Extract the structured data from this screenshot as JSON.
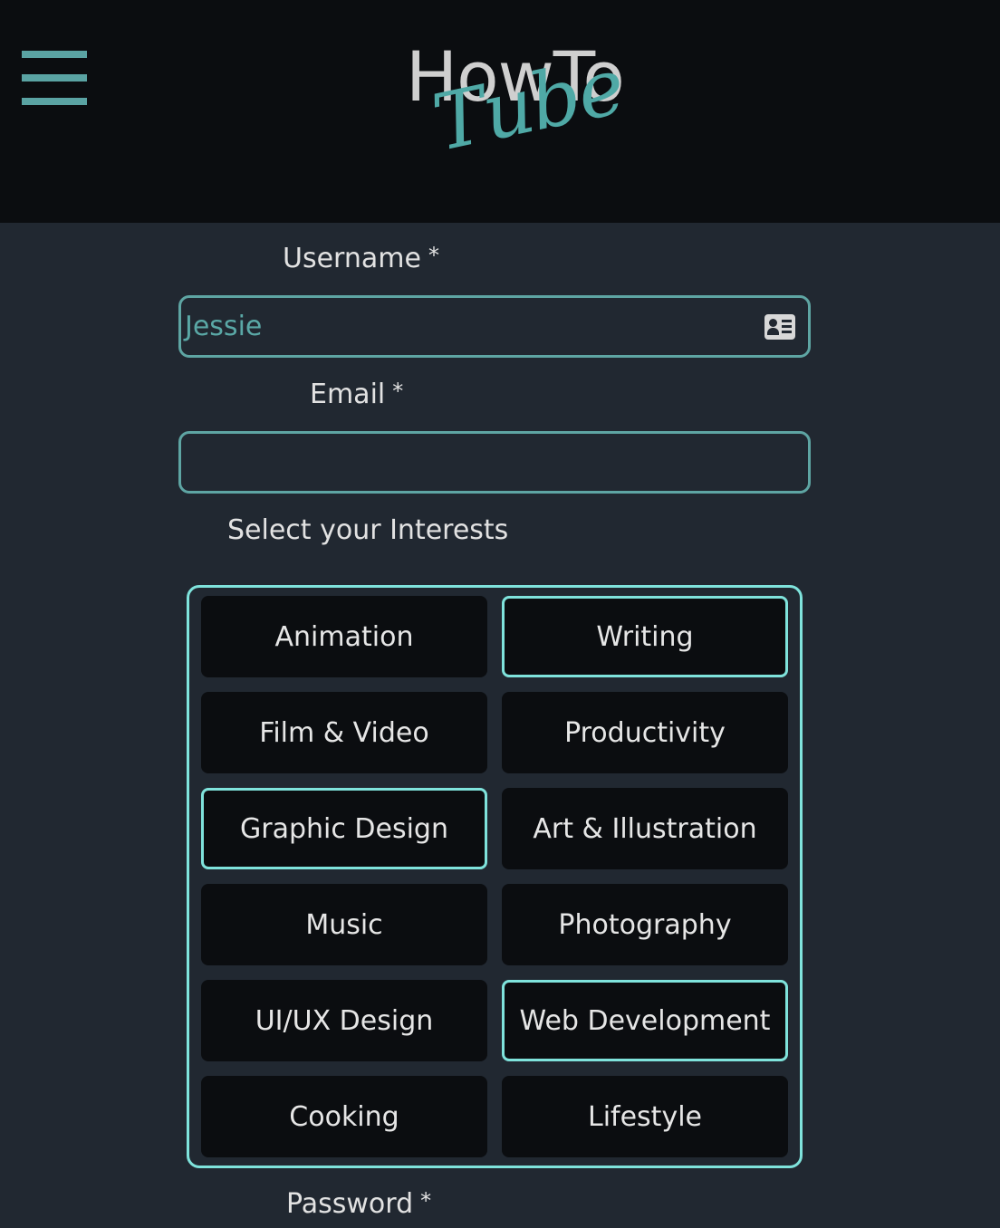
{
  "header": {
    "menu_icon": "hamburger-menu-icon",
    "logo_top": "HowTo",
    "logo_bottom": "Tube"
  },
  "form": {
    "username": {
      "label": "Username",
      "required_mark": "*",
      "value": "Jessie",
      "icon": "contact-card-icon"
    },
    "email": {
      "label": "Email",
      "required_mark": "*",
      "value": ""
    },
    "interests": {
      "label": "Select your Interests",
      "items": [
        {
          "label": "Animation",
          "selected": false
        },
        {
          "label": "Writing",
          "selected": true
        },
        {
          "label": "Film & Video",
          "selected": false
        },
        {
          "label": "Productivity",
          "selected": false
        },
        {
          "label": "Graphic Design",
          "selected": true
        },
        {
          "label": "Art & Illustration",
          "selected": false
        },
        {
          "label": "Music",
          "selected": false
        },
        {
          "label": "Photography",
          "selected": false
        },
        {
          "label": "UI/UX Design",
          "selected": false
        },
        {
          "label": "Web Development",
          "selected": true
        },
        {
          "label": "Cooking",
          "selected": false
        },
        {
          "label": "Lifestyle",
          "selected": false
        }
      ]
    },
    "password": {
      "label": "Password",
      "required_mark": "*"
    }
  },
  "colors": {
    "header_bg": "#0b0d10",
    "page_bg": "#212831",
    "accent": "#5ea5a3",
    "selected_border": "#7fe3dc"
  }
}
